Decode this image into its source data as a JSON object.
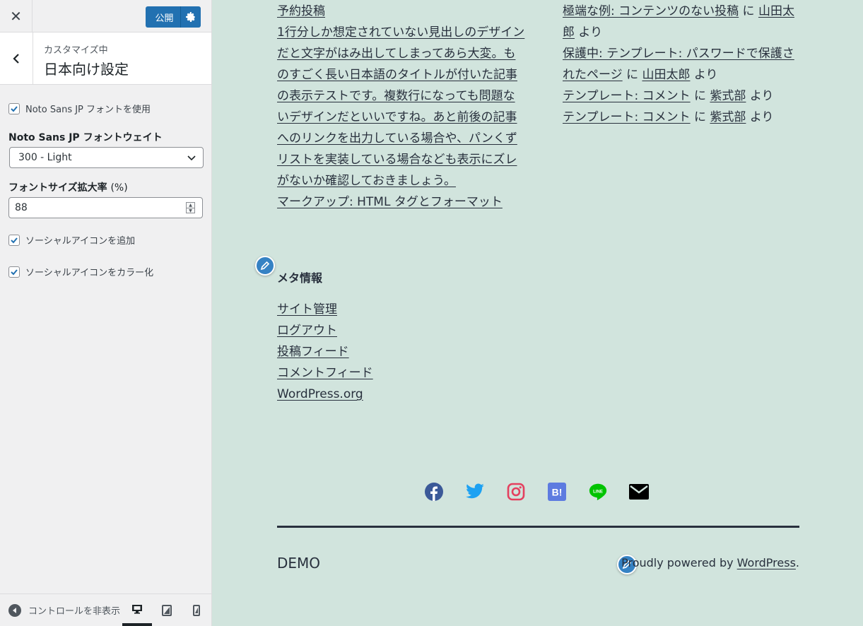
{
  "customizer": {
    "close_label": "✕",
    "publish_label": "公開",
    "section_sub": "カスタマイズ中",
    "section_title": "日本向け設定",
    "use_font_label": "Noto Sans JP フォントを使用",
    "use_font_checked": true,
    "weight_label": "Noto Sans JP フォントウェイト",
    "weight_value": "300 - Light",
    "scale_label": "フォントサイズ拡大率",
    "scale_unit": "(%)",
    "scale_value": "88",
    "social_add_label": "ソーシャルアイコンを追加",
    "social_add_checked": true,
    "social_color_label": "ソーシャルアイコンをカラー化",
    "social_color_checked": true,
    "collapse_label": "コントロールを非表示"
  },
  "preview": {
    "left_links": [
      "予約投稿",
      "1行分しか想定されていない見出しのデザインだと文字がはみ出してしまってあら大変。ものすごく長い日本語のタイトルが付いた記事の表示テストです。複数行になっても問題ないデザインだといいですね。あと前後の記事へのリンクを出力している場合や、パンくずリストを実装している場合なども表示にズレがないか確認しておきましょう。",
      "マークアップ: HTML タグとフォーマット"
    ],
    "recent_comments": [
      {
        "post": "極端な例: コンテンツのない投稿",
        "sep": " に ",
        "author": "山田太郎",
        "suffix": " より"
      },
      {
        "post": "保護中: テンプレート: パスワードで保護されたページ",
        "sep": " に ",
        "author": "山田太郎",
        "suffix": " より"
      },
      {
        "post": "テンプレート: コメント",
        "sep": " に ",
        "author": "紫式部",
        "suffix": " より"
      },
      {
        "post": "テンプレート: コメント",
        "sep": " に ",
        "author": "紫式部",
        "suffix": " より"
      }
    ],
    "meta_title": "メタ情報",
    "meta_links": [
      "サイト管理",
      "ログアウト",
      "投稿フィード",
      "コメントフィード",
      "WordPress.org"
    ],
    "social_icons": [
      "facebook-icon",
      "twitter-icon",
      "instagram-icon",
      "hatena-bookmark-icon",
      "line-icon",
      "mail-icon"
    ],
    "hatena_text": "B!",
    "line_text": "LINE",
    "site_name": "DEMO",
    "powered_prefix": "Proudly powered by ",
    "powered_link": "WordPress",
    "powered_suffix": "."
  },
  "colors": {
    "preview_bg": "#d1e4dd",
    "accent": "#2271b1",
    "text": "#28303d"
  }
}
